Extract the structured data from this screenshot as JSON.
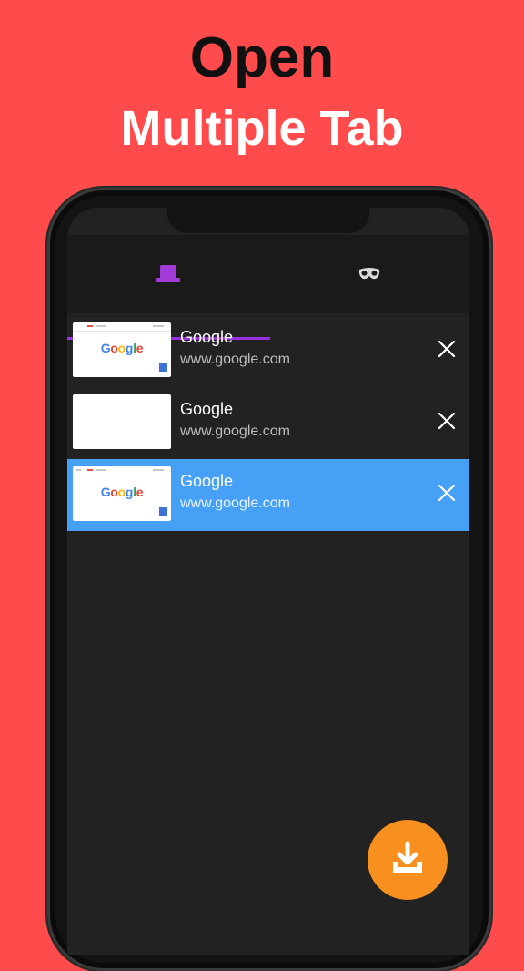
{
  "headline": {
    "line1": "Open",
    "line2": "Multiple Tab"
  },
  "tabbar": {
    "tabs": [
      {
        "icon": "tabs-icon",
        "selected": true
      },
      {
        "icon": "incognito-mask-icon",
        "selected": false
      }
    ],
    "accent_color": "#9b30e0"
  },
  "tab_list": [
    {
      "title": "Google",
      "url": "www.google.com",
      "thumbnail": "google-homepage",
      "active": false
    },
    {
      "title": "Google",
      "url": "www.google.com",
      "thumbnail": "blank",
      "active": false
    },
    {
      "title": "Google",
      "url": "www.google.com",
      "thumbnail": "google-homepage",
      "active": true
    }
  ],
  "thumbnail_logo": "Google",
  "fab": {
    "icon": "download-icon",
    "color": "#f7901e"
  },
  "colors": {
    "background": "#ff4b4b",
    "active_row": "#46a0f6",
    "screen": "#222222"
  }
}
